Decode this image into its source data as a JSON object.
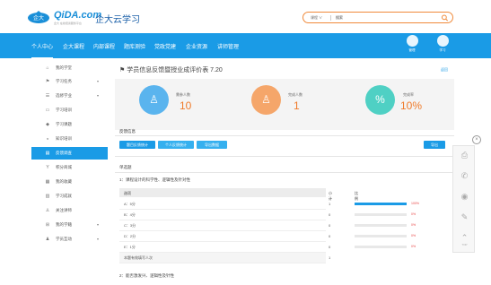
{
  "header": {
    "logo_text": "QiDA.com",
    "logo_sub": "企大 在线培训服务平台",
    "title": "企大云学习",
    "search_type": "课程 ∨",
    "search_value": "搜索"
  },
  "nav": {
    "items": [
      {
        "label": "个人中心",
        "active": true
      },
      {
        "label": "企大课程"
      },
      {
        "label": "内部课程"
      },
      {
        "label": "题库测验"
      },
      {
        "label": "党政党建"
      },
      {
        "label": "企业资源"
      },
      {
        "label": "讲师管理"
      }
    ],
    "right": [
      {
        "label": "管理"
      },
      {
        "label": "学习"
      }
    ]
  },
  "sidebar": {
    "items": [
      {
        "icon": "home-icon",
        "glyph": "⌂",
        "label": "我的学堂"
      },
      {
        "icon": "flag-icon",
        "glyph": "⚑",
        "label": "学习任务",
        "arrow": "▾"
      },
      {
        "icon": "list-icon",
        "glyph": "☰",
        "label": "选修学业",
        "arrow": "▾"
      },
      {
        "icon": "monitor-icon",
        "glyph": "▭",
        "label": "学习培训"
      },
      {
        "icon": "cap-icon",
        "glyph": "◆",
        "label": "学习课题"
      },
      {
        "icon": "chart-icon",
        "glyph": "◒",
        "label": "知识培训"
      },
      {
        "icon": "feedback-icon",
        "glyph": "▤",
        "label": "反馈调查",
        "active": true
      },
      {
        "icon": "points-icon",
        "glyph": "Y",
        "label": "积分商城"
      },
      {
        "icon": "doc-icon",
        "glyph": "▦",
        "label": "我的收藏"
      },
      {
        "icon": "book-icon",
        "glyph": "▥",
        "label": "学习成就"
      },
      {
        "icon": "people-icon",
        "glyph": "♙",
        "label": "关注讲师"
      },
      {
        "icon": "lock-icon",
        "glyph": "⊞",
        "label": "我的学籍",
        "arrow": "▾"
      },
      {
        "icon": "group-icon",
        "glyph": "♟",
        "label": "学员互动",
        "arrow": "▾"
      }
    ]
  },
  "main": {
    "title": "学员信息反馈暨授业成评价表 7.20",
    "back": "返回",
    "stats": [
      {
        "label": "需参人数",
        "value": "10",
        "glyph": "♙",
        "color": "#5ab4ee"
      },
      {
        "label": "完成人数",
        "value": "1",
        "glyph": "♙",
        "color": "#f5a66a"
      },
      {
        "label": "完成率",
        "value": "10%",
        "glyph": "%",
        "color": "#4fd0c4"
      }
    ],
    "section_title": "反馈信息",
    "tabs": [
      "题目反馈统计",
      "个人反馈统计",
      "导出数据"
    ],
    "export": "导出",
    "question_section": "单选题",
    "question1": "1：课程设计的科学性、逻辑性及针对性",
    "table_headers": [
      "选项",
      "小计",
      "比例"
    ],
    "rows": [
      {
        "option": "A：5分",
        "count": "1",
        "ratio": 1.0,
        "pct": "100%"
      },
      {
        "option": "B：4分",
        "count": "0",
        "ratio": 0,
        "pct": "0%"
      },
      {
        "option": "C：3分",
        "count": "0",
        "ratio": 0,
        "pct": "0%"
      },
      {
        "option": "D：2分",
        "count": "0",
        "ratio": 0,
        "pct": "0%"
      },
      {
        "option": "E：1分",
        "count": "0",
        "ratio": 0,
        "pct": "0%"
      }
    ],
    "total_label": "本题有效填写人次",
    "total_value": "1",
    "question2": "2：能否激发兴、逻辑性及针性"
  },
  "float": {
    "close": "×",
    "items": [
      {
        "icon": "printer-icon",
        "glyph": "⎙"
      },
      {
        "icon": "phone-icon",
        "glyph": "✆"
      },
      {
        "icon": "eye-icon",
        "glyph": "◉"
      },
      {
        "icon": "edit-icon",
        "glyph": "✎"
      },
      {
        "icon": "top-icon",
        "glyph": "⌃",
        "label": "TOP"
      }
    ]
  },
  "colors": {
    "primary": "#1a9be6",
    "accent": "#f07b2a",
    "danger": "#e84545"
  }
}
